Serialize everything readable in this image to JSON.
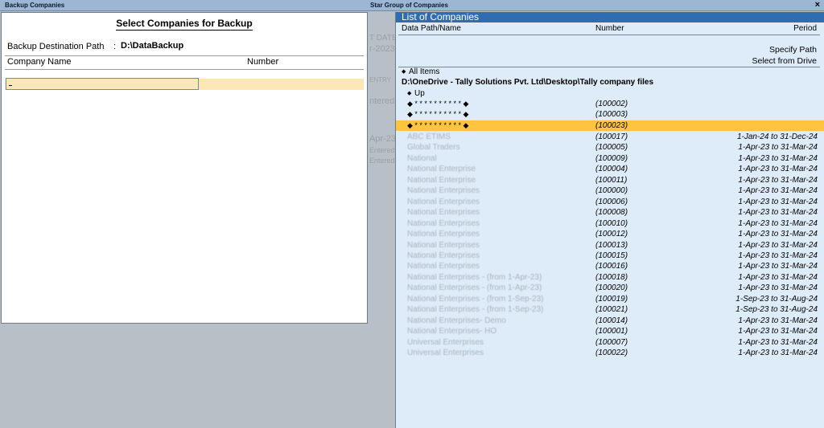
{
  "titlebar": {
    "left_title": "Backup Companies",
    "mid_title": "Star Group of Companies",
    "close": "×"
  },
  "ghost": [
    "T DATE",
    "r-2023",
    "ENTRY",
    "ntered",
    "Apr-23",
    "Entered",
    "Entered"
  ],
  "backup_panel": {
    "title": "Select Companies for Backup",
    "dest_label": "Backup Destination Path",
    "dest_colon": ":",
    "dest_value": "D:\\DataBackup",
    "col_company": "Company Name",
    "col_number": "Number"
  },
  "list_panel": {
    "title": "List of Companies",
    "col_path": "Data Path/Name",
    "col_number": "Number",
    "col_period": "Period",
    "specify_path": "Specify Path",
    "select_drive": "Select from Drive",
    "all_items": "All Items",
    "path": "D:\\OneDrive - Tally Solutions Pvt. Ltd\\Desktop\\Tally company files",
    "up": "Up",
    "bullet": "◆",
    "masked_rows": [
      {
        "name": "◆ * * * * * * * * * * ◆",
        "number": "(100002)",
        "period": "",
        "selected": false
      },
      {
        "name": "◆ * * * * * * * * * * ◆",
        "number": "(100003)",
        "period": "",
        "selected": false
      },
      {
        "name": "◆ * * * * * * * * * * ◆",
        "number": "(100023)",
        "period": "",
        "selected": true
      }
    ],
    "companies": [
      {
        "name": "ABC ETIMS",
        "number": "(100017)",
        "period": "1-Jan-24 to 31-Dec-24"
      },
      {
        "name": "Global Traders",
        "number": "(100005)",
        "period": "1-Apr-23 to 31-Mar-24"
      },
      {
        "name": "National",
        "number": "(100009)",
        "period": "1-Apr-23 to 31-Mar-24"
      },
      {
        "name": "National Enterprise",
        "number": "(100004)",
        "period": "1-Apr-23 to 31-Mar-24"
      },
      {
        "name": "National Enterprise",
        "number": "(100011)",
        "period": "1-Apr-23 to 31-Mar-24"
      },
      {
        "name": "National Enterprises",
        "number": "(100000)",
        "period": "1-Apr-23 to 31-Mar-24"
      },
      {
        "name": "National Enterprises",
        "number": "(100006)",
        "period": "1-Apr-23 to 31-Mar-24"
      },
      {
        "name": "National Enterprises",
        "number": "(100008)",
        "period": "1-Apr-23 to 31-Mar-24"
      },
      {
        "name": "National Enterprises",
        "number": "(100010)",
        "period": "1-Apr-23 to 31-Mar-24"
      },
      {
        "name": "National Enterprises",
        "number": "(100012)",
        "period": "1-Apr-23 to 31-Mar-24"
      },
      {
        "name": "National Enterprises",
        "number": "(100013)",
        "period": "1-Apr-23 to 31-Mar-24"
      },
      {
        "name": "National Enterprises",
        "number": "(100015)",
        "period": "1-Apr-23 to 31-Mar-24"
      },
      {
        "name": "National Enterprises",
        "number": "(100016)",
        "period": "1-Apr-23 to 31-Mar-24"
      },
      {
        "name": "National Enterprises - (from 1-Apr-23)",
        "number": "(100018)",
        "period": "1-Apr-23 to 31-Mar-24"
      },
      {
        "name": "National Enterprises - (from 1-Apr-23)",
        "number": "(100020)",
        "period": "1-Apr-23 to 31-Mar-24"
      },
      {
        "name": "National Enterprises - (from 1-Sep-23)",
        "number": "(100019)",
        "period": "1-Sep-23 to 31-Aug-24"
      },
      {
        "name": "National Enterprises - (from 1-Sep-23)",
        "number": "(100021)",
        "period": "1-Sep-23 to 31-Aug-24"
      },
      {
        "name": "National Enterprises- Demo",
        "number": "(100014)",
        "period": "1-Apr-23 to 31-Mar-24"
      },
      {
        "name": "National Enterprises- HO",
        "number": "(100001)",
        "period": "1-Apr-23 to 31-Mar-24"
      },
      {
        "name": "Universal Enterprises",
        "number": "(100007)",
        "period": "1-Apr-23 to 31-Mar-24"
      },
      {
        "name": "Universal Enterprises",
        "number": "(100022)",
        "period": "1-Apr-23 to 31-Mar-24"
      }
    ]
  }
}
